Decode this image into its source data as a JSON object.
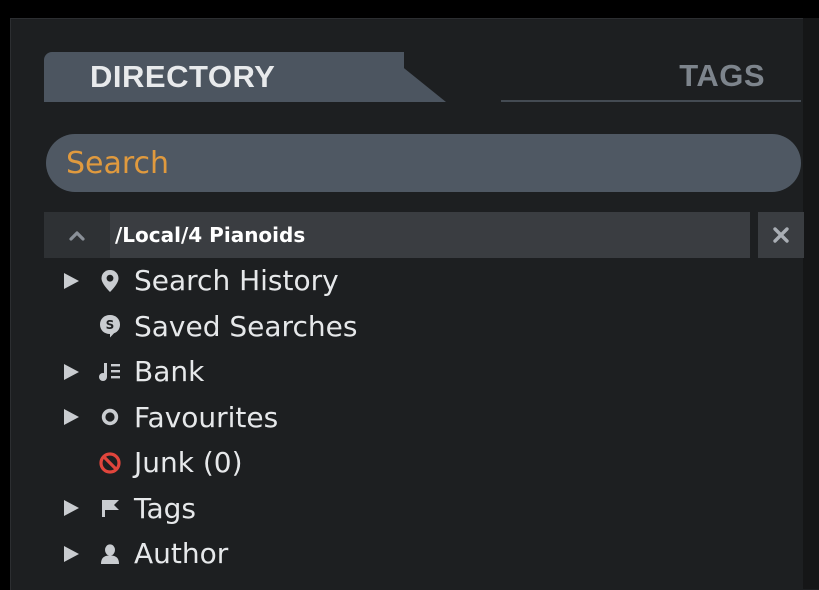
{
  "tabs": {
    "directory": "DIRECTORY",
    "tags": "TAGS"
  },
  "search": {
    "placeholder": "Search"
  },
  "path": {
    "value": "/Local/4 Pianoids"
  },
  "tree": {
    "items": [
      {
        "label": "Search History",
        "icon": "location-pin-icon",
        "expandable": true
      },
      {
        "label": "Saved Searches",
        "icon": "saved-search-icon",
        "expandable": false
      },
      {
        "label": "Bank",
        "icon": "bank-icon",
        "expandable": true
      },
      {
        "label": "Favourites",
        "icon": "favourite-circle-icon",
        "expandable": true
      },
      {
        "label": "Junk (0)",
        "icon": "junk-icon",
        "expandable": false
      },
      {
        "label": "Tags",
        "icon": "flag-icon",
        "expandable": true
      },
      {
        "label": "Author",
        "icon": "person-icon",
        "expandable": true
      }
    ]
  },
  "colors": {
    "accent": "#e09a3e",
    "junk": "#e0453c",
    "panel": "#1d1f21",
    "tab_active": "#4c5560"
  }
}
